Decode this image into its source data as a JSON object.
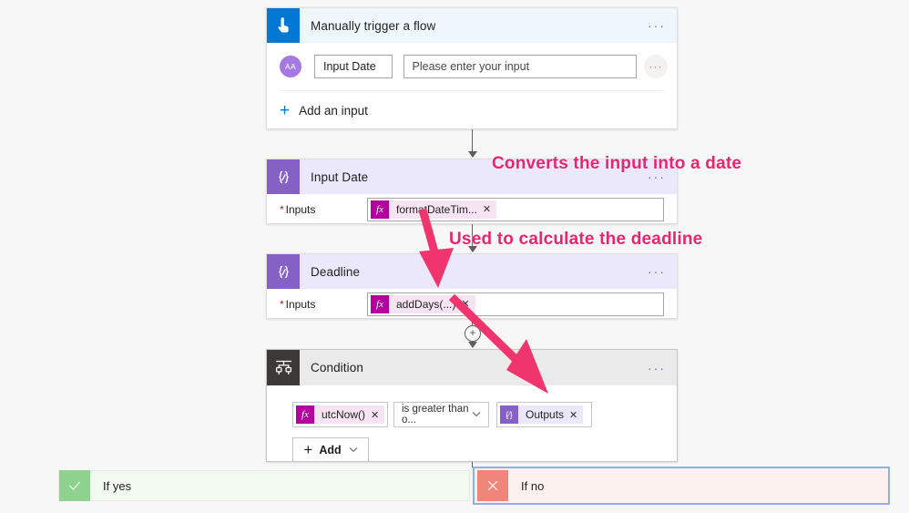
{
  "canvas": {
    "background": "#f7f7f7",
    "accent_blue": "#0078d4",
    "accent_purple": "#8661c5",
    "annotation_pink": "#e8266f"
  },
  "trigger": {
    "icon": "hand-tap-icon",
    "title": "Manually trigger a flow",
    "more_label": "···",
    "input": {
      "avatar_initials": "AA",
      "name_value": "Input Date",
      "placeholder_value": "Please enter your input",
      "row_more_label": "···"
    },
    "add_input_label": "Add an input",
    "add_input_plus": "+"
  },
  "compose_input_date": {
    "icon": "compose-braces-icon",
    "title": "Input Date",
    "more_label": "···",
    "field_label": "Inputs",
    "required_marker": "*",
    "token": {
      "icon_label": "fx",
      "label": "formatDateTim...",
      "remove_label": "✕"
    }
  },
  "compose_deadline": {
    "icon": "compose-braces-icon",
    "title": "Deadline",
    "more_label": "···",
    "field_label": "Inputs",
    "required_marker": "*",
    "token": {
      "icon_label": "fx",
      "label": "addDays(...)",
      "remove_label": "✕"
    }
  },
  "condition": {
    "icon": "condition-branch-icon",
    "title": "Condition",
    "more_label": "···",
    "left_token": {
      "icon_label": "fx",
      "label": "utcNow()",
      "remove_label": "✕"
    },
    "operator": {
      "value": "is greater than o...",
      "chevron": "⌄"
    },
    "right_token": {
      "icon_label": "{∕}",
      "label": "Outputs",
      "remove_label": "✕"
    },
    "add_button": {
      "plus": "+",
      "label": "Add",
      "chevron": "⌄"
    }
  },
  "branches": [
    {
      "name": "if-yes",
      "icon": "check-icon",
      "label": "If yes"
    },
    {
      "name": "if-no",
      "icon": "cross-icon",
      "label": "If no"
    }
  ],
  "connectors": {
    "plus_label": "+"
  },
  "annotations": [
    {
      "name": "annotation-converts",
      "text": "Converts the input into a date"
    },
    {
      "name": "annotation-deadline",
      "text": "Used to calculate the deadline"
    }
  ]
}
